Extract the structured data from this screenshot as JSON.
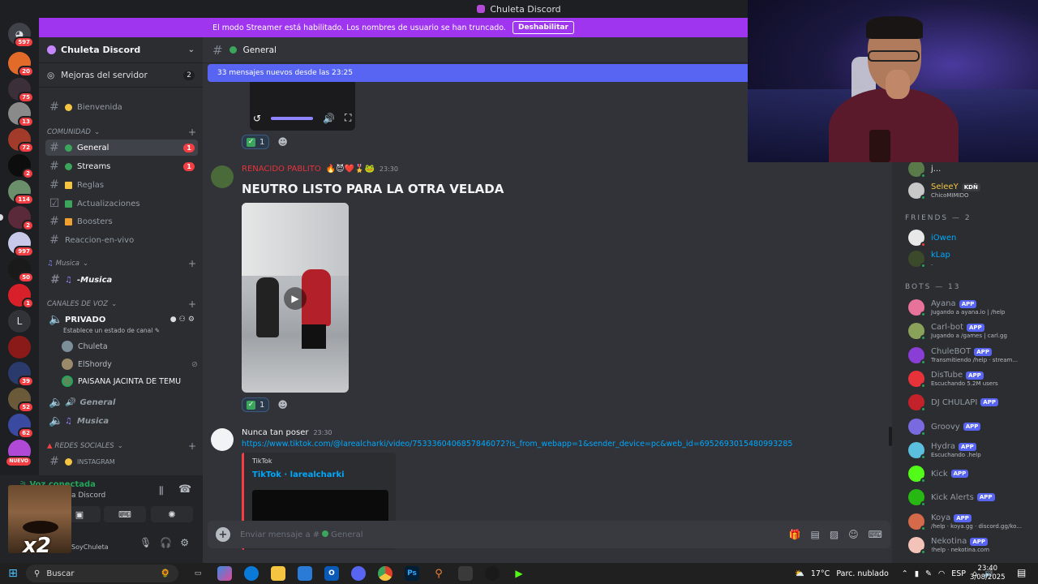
{
  "window": {
    "title": "Chuleta Discord"
  },
  "banner": {
    "text": "El modo Streamer está habilitado. Los nombres de usuario se han truncado.",
    "button": "Deshabilitar"
  },
  "server_rail": {
    "badges": [
      "597",
      "20",
      "75",
      "13",
      "72",
      "2",
      "114",
      "2",
      "997",
      "50",
      "1",
      "39",
      "52",
      "62",
      "NUEVO"
    ],
    "letter_item": "L"
  },
  "sidebar": {
    "guild_name": "Chuleta Discord",
    "boost_label": "Mejoras del servidor",
    "boost_count": "2",
    "channels": {
      "bienvenida": "Bienvenida",
      "general": "General",
      "general_badge": "1",
      "streams": "Streams",
      "streams_badge": "1",
      "reglas": "Reglas",
      "actualizaciones": "Actualizaciones",
      "boosters": "Boosters",
      "reaccion": "Reaccion-en-vivo",
      "musica_text": "-Musica",
      "instagram": "INSTAGRAM"
    },
    "categories": {
      "comunidad": "COMUNIDAD",
      "musica": "Musica",
      "voz": "CANALES DE VOZ",
      "redes": "REDES SOCIALES"
    },
    "voice": {
      "privado": "PRIVADO",
      "privado_status": "Establece un estado de canal",
      "users": [
        "Chuleta",
        "ElShordy",
        "PAISANA JACINTA DE TEMU"
      ],
      "general": "General",
      "musica": "Musica"
    }
  },
  "user_panel": {
    "voice_connected": "Voz conectada",
    "voice_server": "a Discord",
    "meme_text": "x2",
    "username": "SoyChuleta"
  },
  "chat": {
    "channel_name": "General",
    "new_messages": "33 mensajes nuevos desde las 23:25",
    "reaction_count_1": "1",
    "message1": {
      "author": "RENACIDO PABLITO",
      "time": "23:30",
      "text": "NEUTRO LISTO PARA LA OTRA VELADA"
    },
    "reaction_count_2": "1",
    "message2": {
      "author": "Nunca tan poser",
      "time": "23:30",
      "link": "https://www.tiktok.com/@larealcharki/video/7533360406857846072?is_from_webapp=1&sender_device=pc&web_id=6952693015480993285",
      "embed_provider": "TikTok",
      "embed_title": "TikTok · larealcharki"
    },
    "composer_placeholder": "Enviar mensaje a #",
    "composer_channel": "General"
  },
  "members": {
    "top": [
      {
        "name": "j...",
        "activity": ""
      },
      {
        "name": "SeleeY",
        "tag": "KDÑ",
        "activity": "ChicoMIMIDO"
      }
    ],
    "friends_header": "FRIENDS — 2",
    "friends": [
      {
        "name": "iOwen",
        "activity": ""
      },
      {
        "name": "kLap",
        "activity": "."
      }
    ],
    "bots_header": "BOTS — 13",
    "bots": [
      {
        "name": "Ayana",
        "tag": "APP",
        "activity": "Jugando a ayana.io | /help",
        "color": "#e8739a"
      },
      {
        "name": "Carl-bot",
        "tag": "APP",
        "activity": "Jugando a /games | carl.gg",
        "color": "#8aa15a"
      },
      {
        "name": "ChuleBOT",
        "tag": "APP",
        "activity": "Transmitiendo /help · stream...",
        "color": "#8a3ed6"
      },
      {
        "name": "DisTube",
        "tag": "APP",
        "activity": "Escuchando 5.2M users",
        "color": "#e8323a"
      },
      {
        "name": "DJ CHULAPI",
        "tag": "APP",
        "activity": "",
        "color": "#c4222a"
      },
      {
        "name": "Groovy",
        "tag": "APP",
        "activity": "",
        "color": "#7a6ae0"
      },
      {
        "name": "Hydra",
        "tag": "APP",
        "activity": "Escuchando .help",
        "color": "#5bc0de"
      },
      {
        "name": "Kick",
        "tag": "APP",
        "activity": "",
        "color": "#53fc18"
      },
      {
        "name": "Kick Alerts",
        "tag": "APP",
        "activity": "",
        "color": "#28b814"
      },
      {
        "name": "Koya",
        "tag": "APP",
        "activity": "/help · koya.gg · discord.gg/ko...",
        "color": "#d46a4a"
      },
      {
        "name": "Nekotina",
        "tag": "APP",
        "activity": "!help · nekotina.com",
        "color": "#f3c2b8"
      }
    ]
  },
  "taskbar": {
    "search": "Buscar",
    "weather": "17°C",
    "weather_desc": "Parc. nublado",
    "lang": "ESP",
    "time": "23:40",
    "date": "3/08/2025"
  }
}
